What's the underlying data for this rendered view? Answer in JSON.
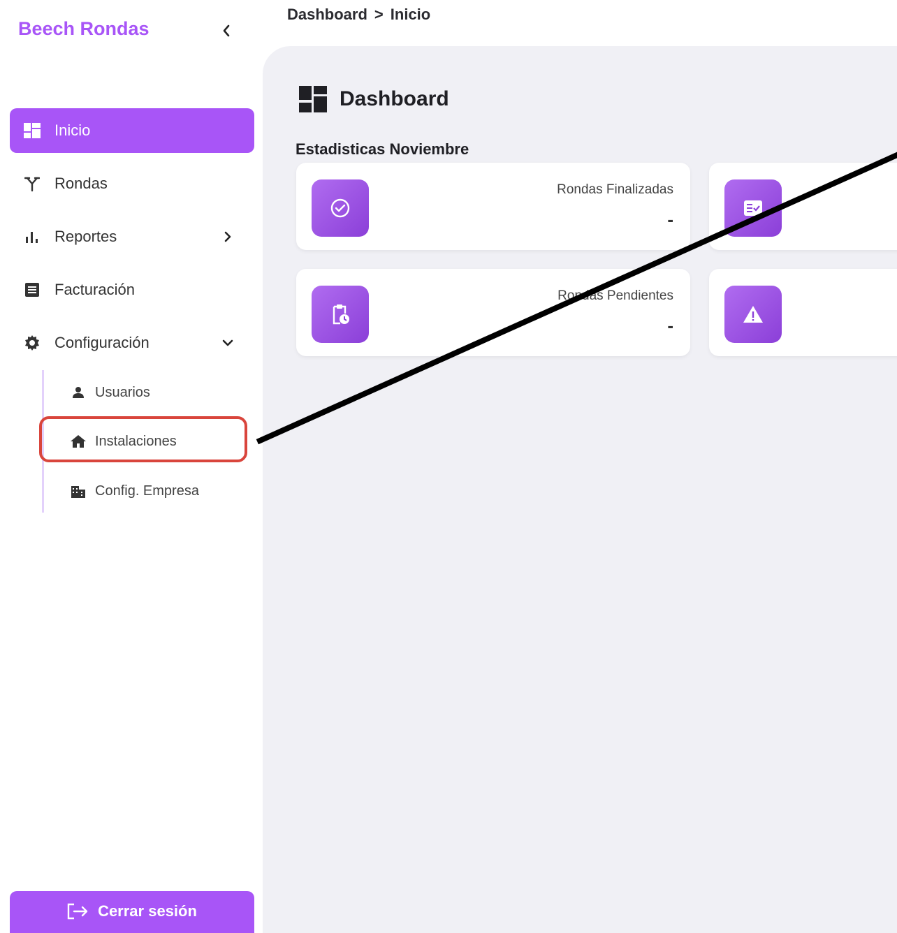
{
  "sidebar": {
    "brand": "Beech Rondas",
    "collapse_icon": "chevron-left-icon",
    "items": [
      {
        "label": "Inicio",
        "icon": "dashboard-icon",
        "active": true
      },
      {
        "label": "Rondas",
        "icon": "fork-icon"
      },
      {
        "label": "Reportes",
        "icon": "bar-chart-icon"
      },
      {
        "label": "Facturación",
        "icon": "receipt-icon"
      },
      {
        "label": "Configuración",
        "icon": "gear-icon"
      }
    ],
    "subitems": [
      {
        "label": "Usuarios",
        "icon": "user-icon"
      },
      {
        "label": "Instalaciones",
        "icon": "home-icon",
        "highlighted": true
      },
      {
        "label": "Config. Empresa",
        "icon": "building-icon"
      }
    ],
    "logout": "Cerrar sesión"
  },
  "breadcrumb": {
    "parent": "Dashboard",
    "separator": ">",
    "current": "Inicio"
  },
  "main": {
    "title": "Dashboard",
    "section_title": "Estadisticas Noviembre",
    "cards": [
      {
        "title": "Rondas Finalizadas",
        "value": "-",
        "icon": "check-circle-icon"
      },
      {
        "title": "",
        "value": "",
        "icon": "checklist-icon"
      },
      {
        "title": "Rondas Pendientes",
        "value": "-",
        "icon": "clipboard-clock-icon"
      },
      {
        "title": "",
        "value": "",
        "icon": "warning-icon"
      }
    ]
  },
  "colors": {
    "accent": "#a855f7",
    "highlight_box": "#d9453c",
    "main_bg": "#f0f0f5"
  }
}
